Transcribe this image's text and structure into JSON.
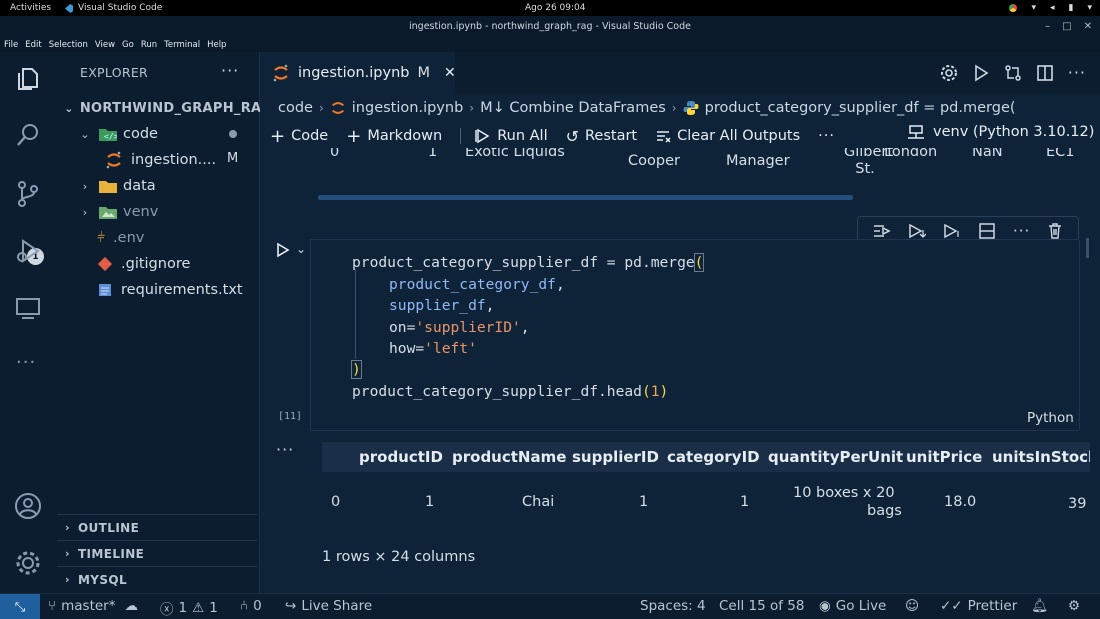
{
  "gnome": {
    "activities": "Activities",
    "app_name": "Visual Studio Code",
    "clock": "Ago 26  09:04"
  },
  "window": {
    "title": "ingestion.ipynb - northwind_graph_rag - Visual Studio Code"
  },
  "menu": [
    "File",
    "Edit",
    "Selection",
    "View",
    "Go",
    "Run",
    "Terminal",
    "Help"
  ],
  "activity": {
    "scm_badge": "1"
  },
  "sidebar": {
    "title": "EXPLORER",
    "more": "···",
    "root": "NORTHWIND_GRAPH_RAG",
    "items": [
      {
        "label": "code"
      },
      {
        "label": "ingestion....",
        "status": "M"
      },
      {
        "label": "data"
      },
      {
        "label": "venv"
      },
      {
        "label": ".env"
      },
      {
        "label": ".gitignore"
      },
      {
        "label": "requirements.txt"
      }
    ],
    "panels": [
      "OUTLINE",
      "TIMELINE",
      "MYSQL"
    ]
  },
  "tab": {
    "label": "ingestion.ipynb",
    "status": "M"
  },
  "breadcrumbs": [
    "code",
    "ingestion.ipynb",
    "M↓ Combine DataFrames",
    "product_category_supplier_df = pd.merge("
  ],
  "toolbar": {
    "code": "Code",
    "markdown": "Markdown",
    "run_all": "Run All",
    "restart": "Restart",
    "clear_outputs": "Clear All Outputs",
    "more": "···",
    "kernel": "venv (Python 3.10.12)"
  },
  "previous_output_row": {
    "cells": [
      "0",
      "1",
      "Exotic Liquids",
      "Cooper",
      "Manager",
      "Gilbert St.",
      "London",
      "NaN",
      "EC1"
    ]
  },
  "cell": {
    "exec_count": "[11]",
    "language": "Python",
    "code": {
      "l1_a": "product_category_supplier_df = pd.merge",
      "l1_b": "(",
      "l2": "product_category_df",
      "l2_tail": ",",
      "l3": "supplier_df",
      "l3_tail": ",",
      "l4_kw": "on=",
      "l4_str": "'supplierID'",
      "l4_tail": ",",
      "l5_kw": "how=",
      "l5_str": "'left'",
      "l6": ")",
      "l7_a": "product_category_supplier_df.head",
      "l7_b": "(",
      "l7_num": "1",
      "l7_c": ")"
    }
  },
  "output": {
    "more": "···",
    "columns": [
      "productID",
      "productName",
      "supplierID",
      "categoryID",
      "quantityPerUnit",
      "unitPrice",
      "unitsInStock"
    ],
    "row": {
      "index": "0",
      "productID": "1",
      "productName": "Chai",
      "supplierID": "1",
      "categoryID": "1",
      "quantityPerUnit_1": "10 boxes x 20",
      "quantityPerUnit_2": "bags",
      "unitPrice": "18.0",
      "unitsInStock": "39"
    },
    "footer": "1 rows × 24 columns"
  },
  "status": {
    "branch": "master*",
    "errors": "1",
    "warnings": "1",
    "ports": "0",
    "live_share": "Live Share",
    "spaces": "Spaces: 4",
    "cell": "Cell 15 of 58",
    "go_live": "Go Live",
    "prettier": "Prettier"
  },
  "colors": {
    "background": "#0f2338",
    "keyword_blue": "#8fb8f7",
    "string_orange": "#e8946a",
    "bracket_yellow": "#f2d64b",
    "number_orange": "#f2a34b"
  }
}
